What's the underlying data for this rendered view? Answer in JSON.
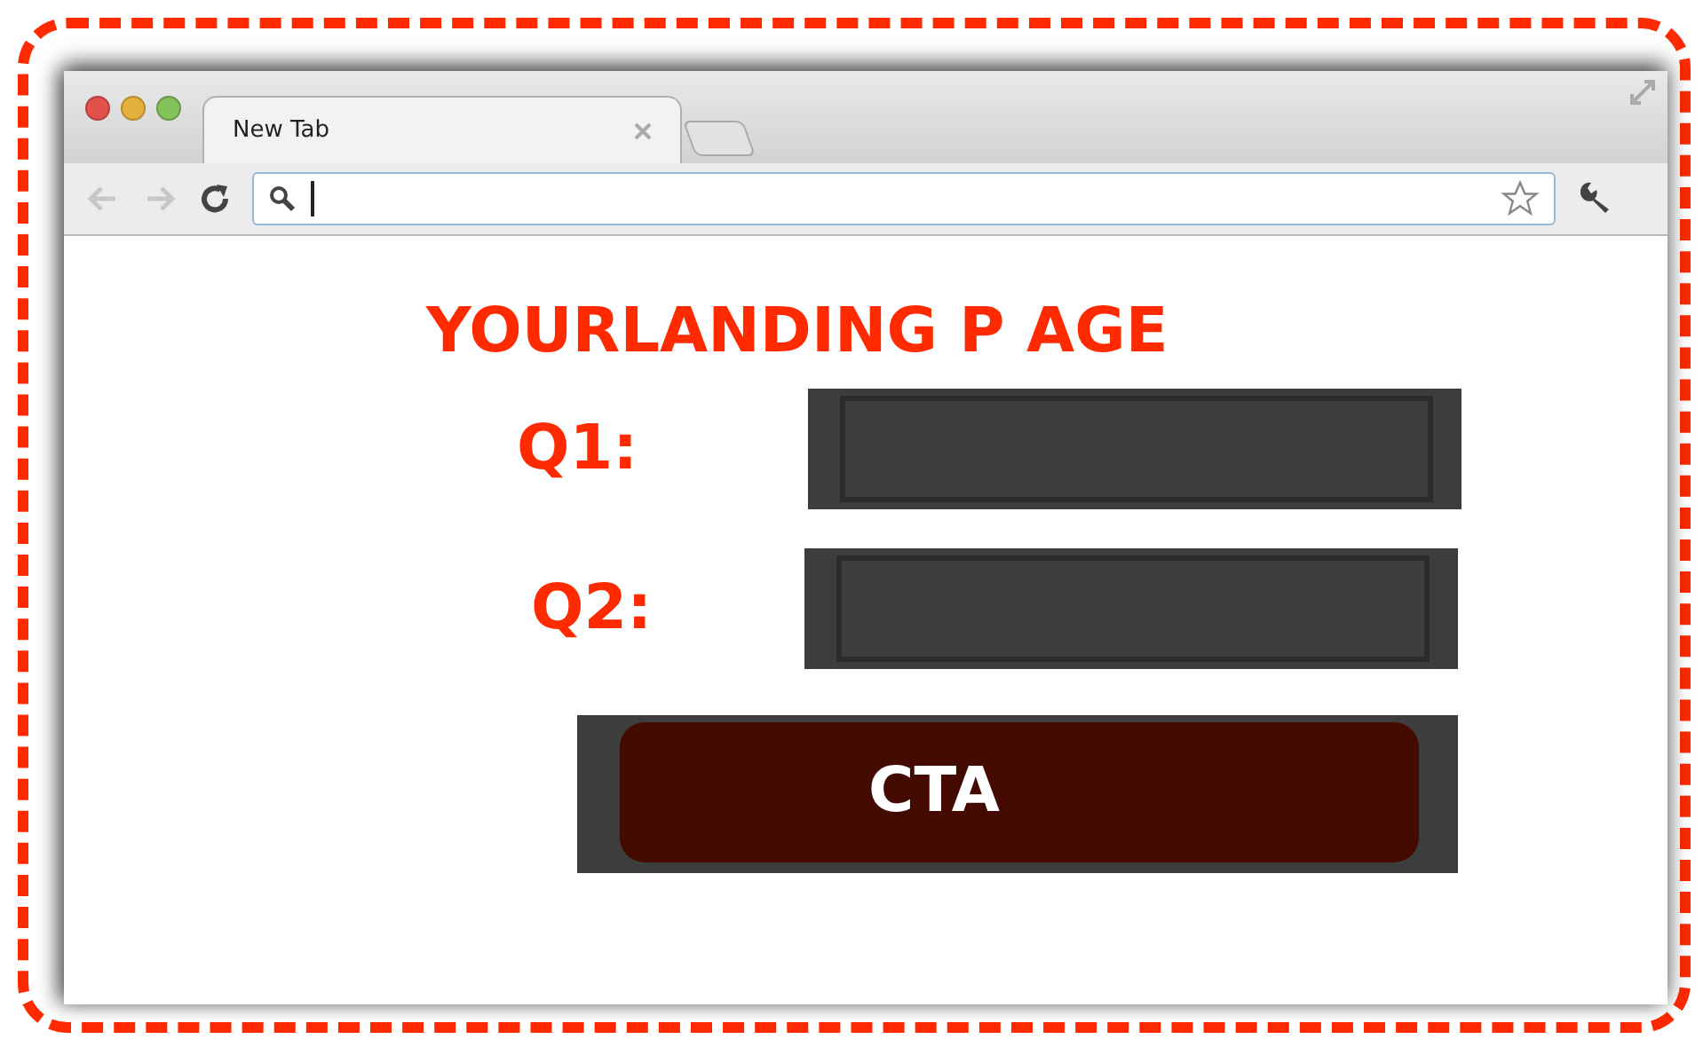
{
  "browser": {
    "tabs": [
      {
        "label": "New Tab",
        "selected": true
      }
    ],
    "back": {
      "disabled": true
    },
    "forward": {
      "disabled": true
    }
  },
  "page": {
    "heading": "YOURLANDING P AGE",
    "questions": [
      {
        "label": "Q1:"
      },
      {
        "label": "Q2:"
      }
    ],
    "cta": "CTA"
  }
}
